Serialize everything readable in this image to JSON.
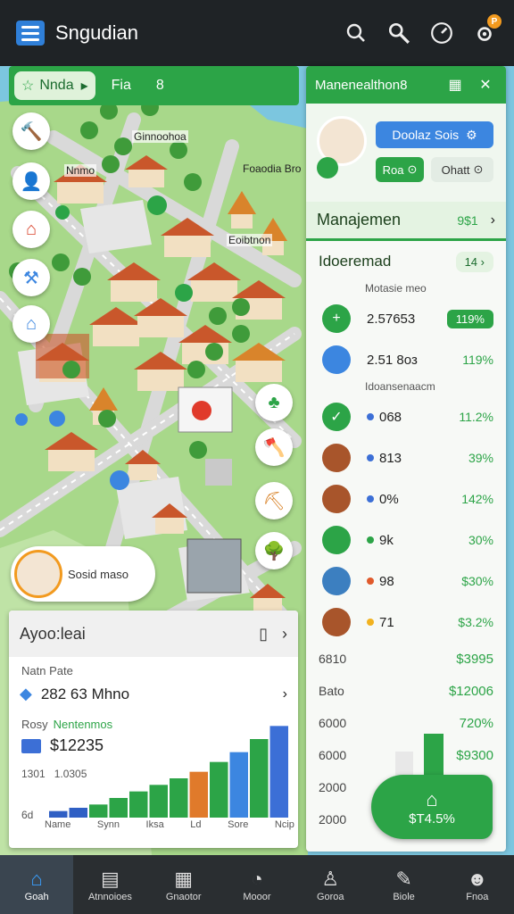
{
  "app": {
    "title": "Sngudian"
  },
  "topbar": {
    "icons": [
      "search-icon",
      "magnifier-icon",
      "compass-icon",
      "settings-icon"
    ],
    "notification_badge": "P"
  },
  "map": {
    "pills": {
      "first": "Nnda",
      "second": "Fia",
      "third": "8"
    },
    "labels": {
      "l1": "Ginnoohoa",
      "l2": "Nnmo",
      "l3": "Foaodia Bro",
      "l4": "Eoibtnon"
    },
    "profile_tag": "Sosid maso"
  },
  "right_panel": {
    "header": "Manenealthon8",
    "profile": {
      "primary_button": "Doolaz Sois",
      "green_button": "Roa",
      "gray_button": "Ohatt"
    },
    "section": {
      "title": "Manajemen",
      "value": "9$1"
    },
    "subsection": {
      "title": "Idoeremad",
      "tag": "14"
    },
    "caption1": "Motasie meo",
    "caption2": "Idoansenaacm",
    "rows": [
      {
        "value": "2.57653",
        "pct": "119%",
        "color": "#2ca447",
        "icon": "plus-icon"
      },
      {
        "value": "2.51 8oз",
        "pct": "119%",
        "color": "#3c86e0",
        "icon": "shield-icon"
      },
      {
        "value": "068",
        "pct": "11.2%",
        "color": "#2ca447",
        "icon": "check-icon",
        "dot": "#3c6fd6"
      },
      {
        "value": "813",
        "pct": "39%",
        "color": "#a8552b",
        "icon": "layers-icon",
        "dot": "#3c6fd6"
      },
      {
        "value": "0%",
        "pct": "142%",
        "color": "#a8552b",
        "icon": "layers-icon",
        "dot": "#3c6fd6"
      },
      {
        "value": "9k",
        "pct": "30%",
        "color": "#2ca447",
        "icon": "chevron-icon",
        "dot": "#2ca447"
      },
      {
        "value": "98",
        "pct": "$30%",
        "color": "#3c7fc0",
        "icon": "circle-icon",
        "dot": "#e05a2b"
      },
      {
        "value": "71",
        "pct": "$3.2%",
        "color": "#a8552b",
        "icon": "barrel-icon",
        "dot": "#f2b21f"
      }
    ],
    "axis": [
      {
        "a": "6810",
        "b": "$3995"
      },
      {
        "a": "Bato",
        "b": "$12006"
      },
      {
        "a": "6000",
        "b": "720%"
      },
      {
        "a": "6000",
        "b": "$9300"
      },
      {
        "a": "2000",
        "b": ""
      },
      {
        "a": "2000",
        "b": ""
      }
    ],
    "fab": {
      "label": "$T4.5%",
      "icon": "house-icon"
    }
  },
  "left_card": {
    "title": "Ayoo:leai",
    "label1": "Natn Pate",
    "value1": "282 63 Mhno",
    "label2": "Rosy",
    "label2b": "Nentenmos",
    "value2": "$12235",
    "label3": "1301",
    "label3b": "1.0305",
    "label4": "6d"
  },
  "chart_data": {
    "type": "bar",
    "categories": [
      "Name",
      "Synn",
      "Iksa",
      "Ld",
      "Sore",
      "Ncip"
    ],
    "values": [
      2,
      3,
      4,
      6,
      8,
      10,
      12,
      14,
      17,
      20,
      24,
      28
    ],
    "colors": [
      "#2f5fc4",
      "#2f5fc4",
      "#2ca447",
      "#2ca447",
      "#2ca447",
      "#2ca447",
      "#2ca447",
      "#e07a2b",
      "#2ca447",
      "#3c86e0",
      "#2ca447",
      "#3c6fd6"
    ],
    "ylim": [
      0,
      30
    ]
  },
  "bottom_nav": [
    {
      "label": "Goah",
      "icon": "home-icon",
      "active": true
    },
    {
      "label": "Atnnoioes",
      "icon": "calendar-icon",
      "active": false
    },
    {
      "label": "Gnaotor",
      "icon": "grid-icon",
      "active": false
    },
    {
      "label": "Mooor",
      "icon": "clock-icon",
      "active": false
    },
    {
      "label": "Goroa",
      "icon": "person-icon",
      "active": false
    },
    {
      "label": "Biole",
      "icon": "edit-icon",
      "active": false
    },
    {
      "label": "Fnoa",
      "icon": "team-icon",
      "active": false
    }
  ]
}
